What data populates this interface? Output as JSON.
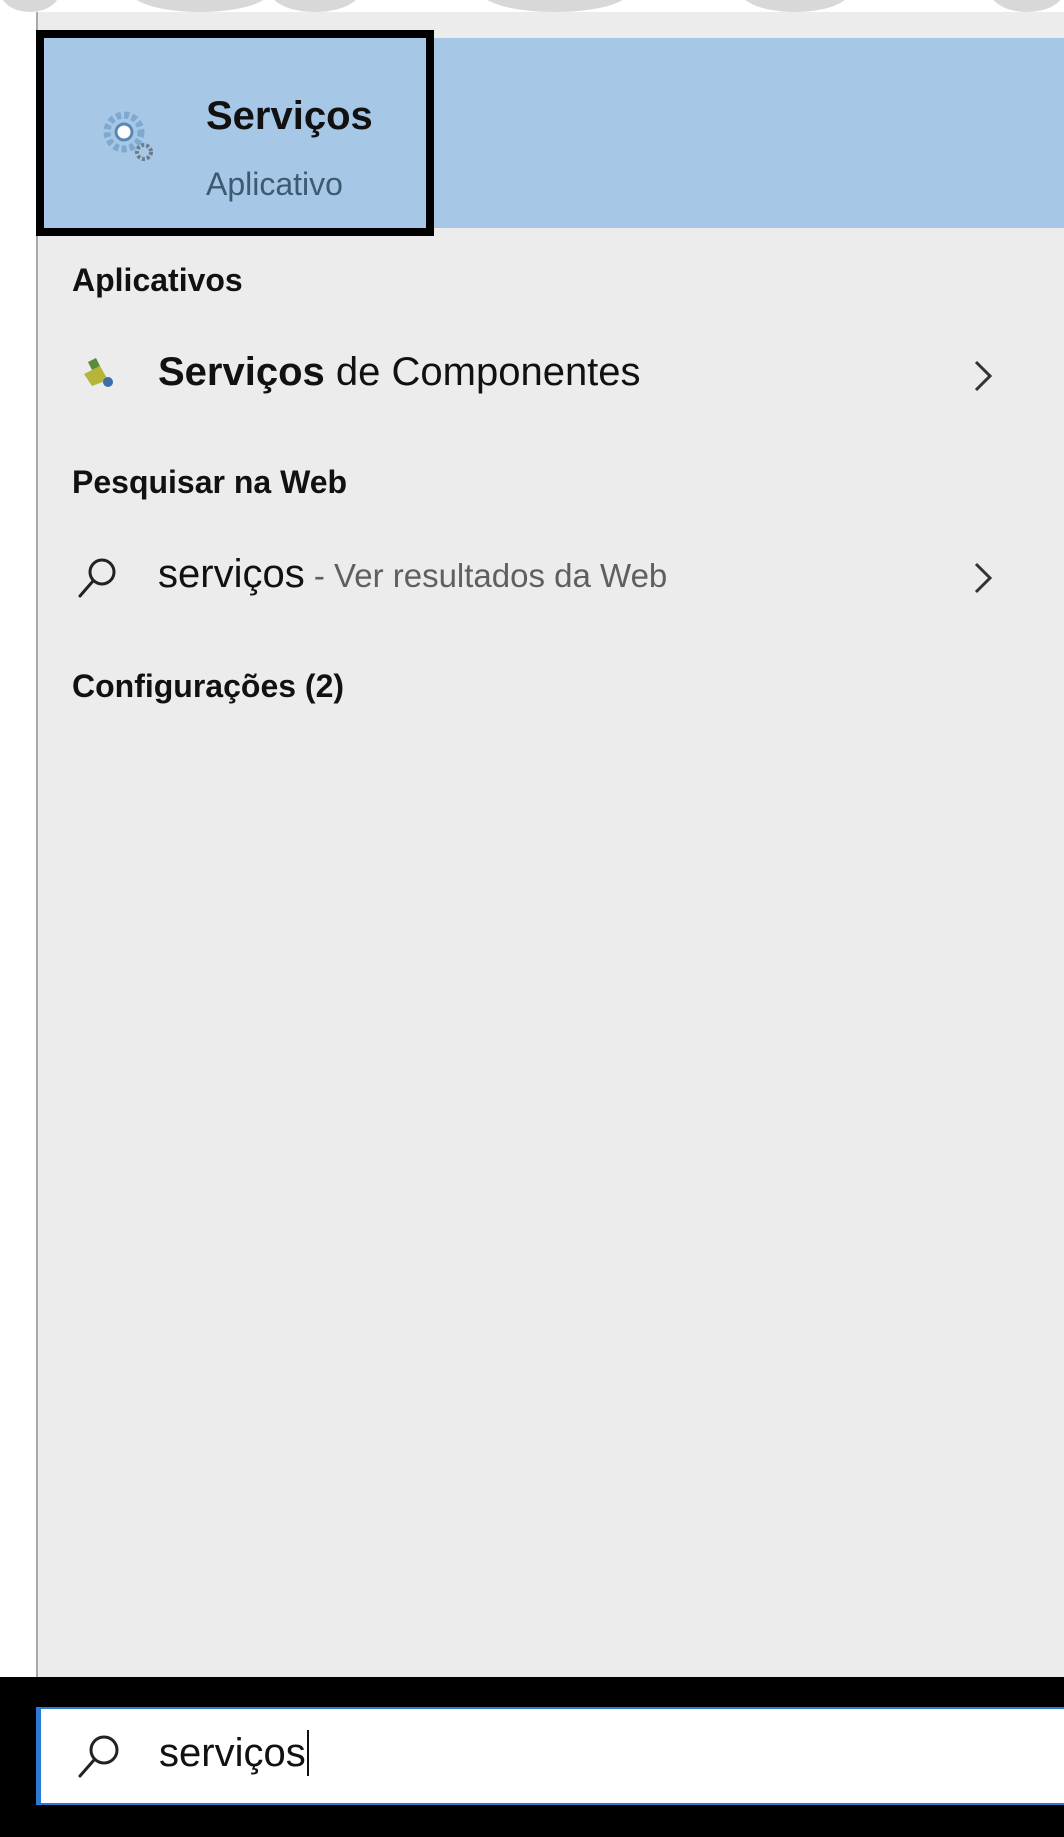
{
  "best_match": {
    "title": "Serviços",
    "subtitle": "Aplicativo",
    "icon": "gear-icon"
  },
  "sections": {
    "apps_header": "Aplicativos",
    "web_header": "Pesquisar na Web",
    "settings_header": "Configurações (2)"
  },
  "apps": [
    {
      "bold": "Serviços",
      "rest": " de Componentes",
      "icon": "component-services-icon"
    }
  ],
  "web": [
    {
      "query": "serviços",
      "suffix": " - Ver resultados da Web",
      "icon": "search-icon"
    }
  ],
  "search": {
    "value": "serviços",
    "icon": "search-icon"
  },
  "colors": {
    "selection": "#a6c8e6",
    "panel": "#ececec",
    "focus_border": "#2c7ad6"
  }
}
